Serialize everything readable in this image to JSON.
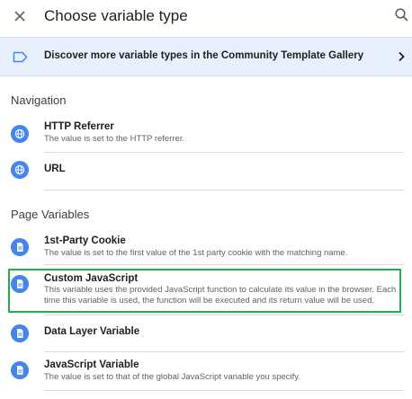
{
  "header": {
    "title": "Choose variable type",
    "close_icon": "close-icon",
    "search_icon": "search-icon"
  },
  "banner": {
    "text": "Discover more variable types in the Community Template Gallery",
    "icon": "tag-outline-icon",
    "chevron": "chevron-right-icon"
  },
  "sections": [
    {
      "heading": "Navigation",
      "items": [
        {
          "title": "HTTP Referrer",
          "description": "The value is set to the HTTP referrer.",
          "icon": "globe-icon"
        },
        {
          "title": "URL",
          "description": "",
          "icon": "globe-icon"
        }
      ]
    },
    {
      "heading": "Page Variables",
      "items": [
        {
          "title": "1st-Party Cookie",
          "description": "The value is set to the first value of the 1st party cookie with the matching name.",
          "icon": "document-icon"
        },
        {
          "title": "Custom JavaScript",
          "description": "This variable uses the provided JavaScript function to calculate its value in the browser. Each time this variable is used, the function will be executed and its return value will be used.",
          "icon": "document-icon",
          "highlighted": true
        },
        {
          "title": "Data Layer Variable",
          "description": "",
          "icon": "document-icon"
        },
        {
          "title": "JavaScript Variable",
          "description": "The value is set to that of the global JavaScript variable you specify.",
          "icon": "document-icon"
        }
      ]
    }
  ],
  "colors": {
    "icon_blue": "#4285f4",
    "banner_bg": "#e8f0fe",
    "highlight_green": "#1eb14b"
  }
}
